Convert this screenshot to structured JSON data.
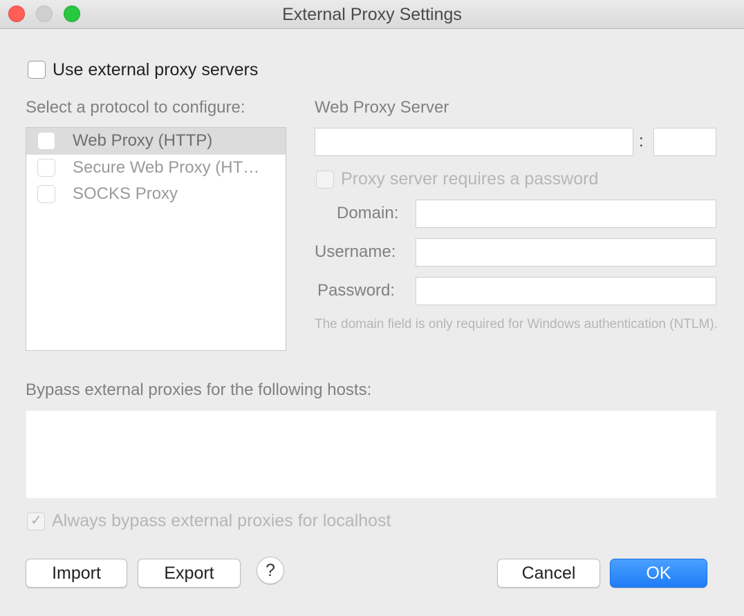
{
  "window": {
    "title": "External Proxy Settings"
  },
  "use_external": {
    "label": "Use external proxy servers",
    "checked": false
  },
  "protocols": {
    "heading": "Select a protocol to configure:",
    "items": [
      {
        "label": "Web Proxy (HTTP)",
        "checked": false,
        "selected": true
      },
      {
        "label": "Secure Web Proxy (HT…",
        "checked": false,
        "selected": false
      },
      {
        "label": "SOCKS Proxy",
        "checked": false,
        "selected": false
      }
    ]
  },
  "server": {
    "heading": "Web Proxy Server",
    "host_value": "",
    "separator": ":",
    "port_value": "",
    "requires_password_label": "Proxy server requires a password",
    "requires_password_checked": false,
    "domain_label": "Domain:",
    "domain_value": "",
    "username_label": "Username:",
    "username_value": "",
    "password_label": "Password:",
    "password_value": "",
    "note": "The domain field is only required for Windows authentication (NTLM)."
  },
  "bypass": {
    "heading": "Bypass external proxies for the following hosts:",
    "hosts_value": "",
    "localhost_label": "Always bypass external proxies for localhost",
    "localhost_checked": true
  },
  "buttons": {
    "import": "Import",
    "export": "Export",
    "help": "?",
    "cancel": "Cancel",
    "ok": "OK"
  },
  "colors": {
    "primary_button": "#1f7cf5",
    "close": "#ff5f57",
    "zoom": "#28c840"
  }
}
